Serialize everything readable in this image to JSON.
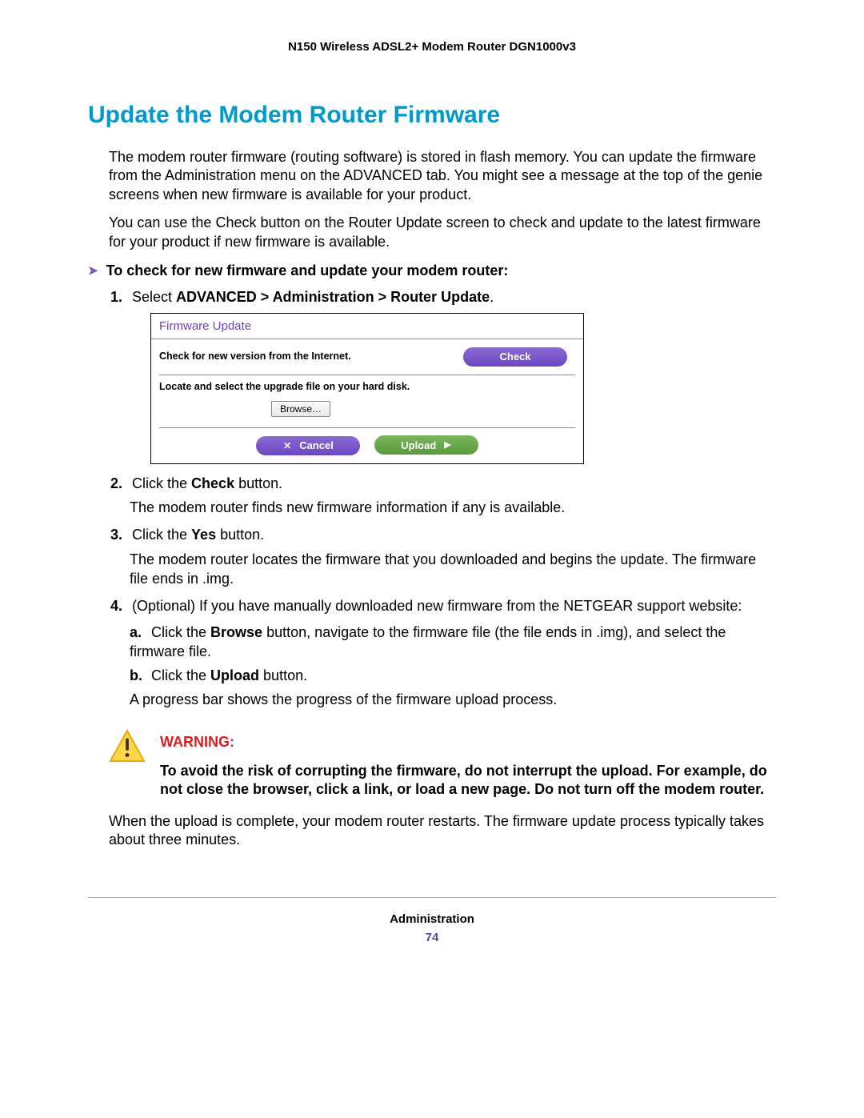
{
  "header": {
    "product": "N150 Wireless ADSL2+ Modem Router DGN1000v3"
  },
  "title": "Update the Modem Router Firmware",
  "intro": [
    "The modem router firmware (routing software) is stored in flash memory. You can update the firmware from the Administration menu on the ADVANCED tab. You might see a message at the top of the genie screens when new firmware is available for your product.",
    "You can use the Check button on the Router Update screen to check and update to the latest firmware for your product if new firmware is available."
  ],
  "procedure_heading": "To check for new firmware and update your modem router:",
  "steps": {
    "s1": {
      "num": "1.",
      "prefix": "Select ",
      "bold": "ADVANCED > Administration > Router Update",
      "suffix": "."
    },
    "s2": {
      "num": "2.",
      "pre": "Click the ",
      "bold": "Check",
      "post": " button.",
      "after": "The modem router finds new firmware information if any is available."
    },
    "s3": {
      "num": "3.",
      "pre": "Click the ",
      "bold": "Yes",
      "post": " button.",
      "after": "The modem router locates the firmware that you downloaded and begins the update. The firmware file ends in .img."
    },
    "s4": {
      "num": "4.",
      "text": "(Optional) If you have manually downloaded new firmware from the NETGEAR support website:",
      "a": {
        "lett": "a.",
        "pre": "Click the ",
        "bold": "Browse",
        "post": " button, navigate to the firmware file (the file ends in .img), and select the firmware file."
      },
      "b": {
        "lett": "b.",
        "pre": "Click the ",
        "bold": "Upload",
        "post": " button."
      },
      "after": "A progress bar shows the progress of the firmware upload process."
    }
  },
  "screenshot": {
    "panel_title": "Firmware Update",
    "check_label": "Check for new version from the Internet.",
    "check_button": "Check",
    "locate_label": "Locate and select the upgrade file on your hard disk.",
    "browse_button": "Browse…",
    "cancel_button": "Cancel",
    "upload_button": "Upload"
  },
  "warning": {
    "label": "WARNING:",
    "text": "To avoid the risk of corrupting the firmware, do not interrupt the upload. For example, do not close the browser, click a link, or load a new page. Do not turn off the modem router."
  },
  "closing": "When the upload is complete, your modem router restarts. The firmware update process typically takes about three minutes.",
  "footer": {
    "section": "Administration",
    "page": "74"
  }
}
